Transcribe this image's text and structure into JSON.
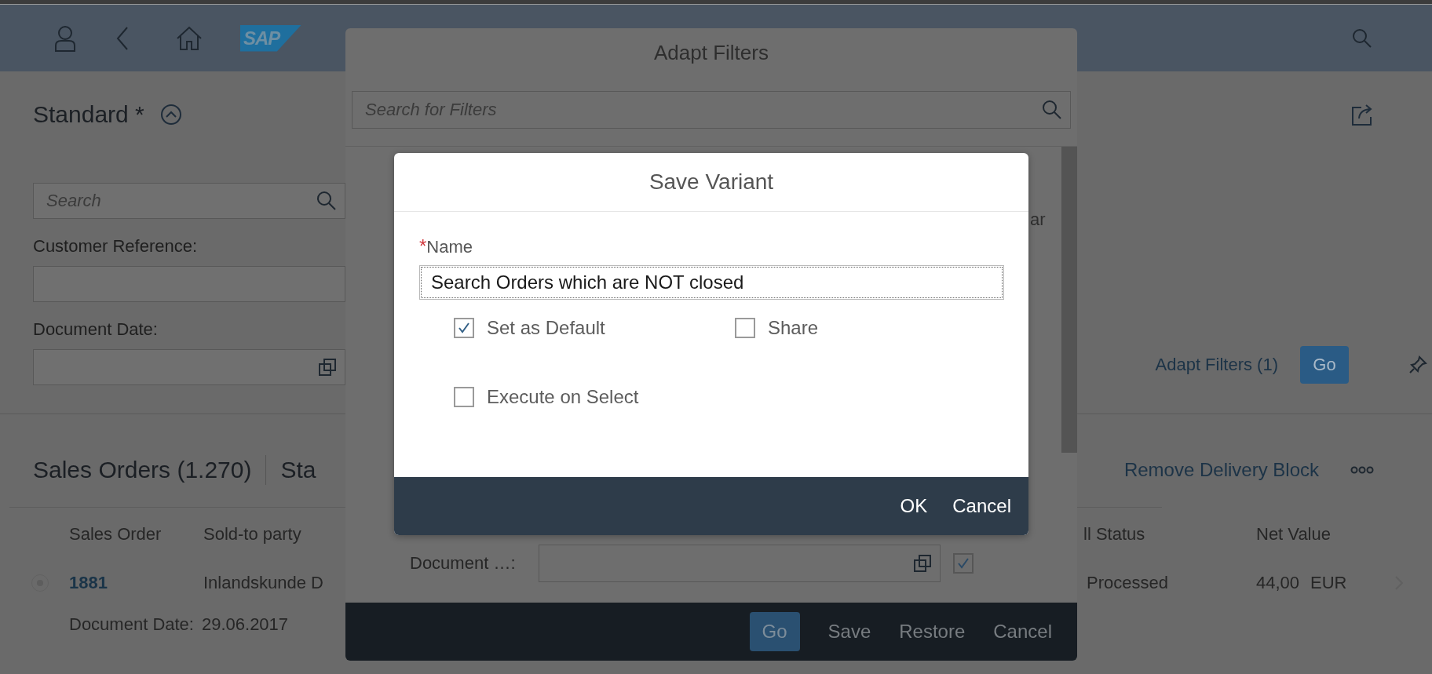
{
  "shell_bar": {
    "logo": "SAP"
  },
  "page": {
    "variant": {
      "title": "Standard *"
    },
    "filter_bar": {
      "search": {
        "placeholder": "Search"
      },
      "fields": [
        {
          "label": "Customer Reference:",
          "kind": "text"
        },
        {
          "label": "Document Date:",
          "kind": "value_help"
        }
      ],
      "adapt_filters": "Adapt Filters (1)",
      "go": "Go"
    },
    "table": {
      "title": "Sales Orders (1.270)",
      "variant": "Sta",
      "actions": [
        "Remove Delivery Block"
      ],
      "columns": [
        "Sales Order",
        "Sold-to party",
        "ll Status",
        "Net Value"
      ],
      "rows": [
        {
          "selected": false,
          "sales_order": "1881",
          "sold_to": "Inlandskunde D",
          "status": "Processed",
          "net_value": "44,00",
          "currency": "EUR",
          "date_label": "Document Date:",
          "date": "29.06.2017"
        }
      ]
    }
  },
  "adapt_filters_dialog": {
    "title": "Adapt Filters",
    "search": {
      "placeholder": "Search for Filters"
    },
    "fragment": "ar",
    "fields": [
      {
        "label": "Document …:",
        "checked": true
      }
    ],
    "buttons": [
      {
        "label": "Go",
        "kind": "emphasized"
      },
      {
        "label": "Save",
        "kind": "plain"
      },
      {
        "label": "Restore",
        "kind": "plain"
      },
      {
        "label": "Cancel",
        "kind": "plain"
      }
    ]
  },
  "save_variant_dialog": {
    "title": "Save Variant",
    "name": {
      "required_mark": "*",
      "label": "Name",
      "value": "Search Orders which are NOT closed"
    },
    "options": [
      {
        "label": "Set as Default",
        "checked": true
      },
      {
        "label": "Share",
        "checked": false
      },
      {
        "label": "Execute on Select",
        "checked": false
      }
    ],
    "buttons": [
      "OK",
      "Cancel"
    ]
  }
}
